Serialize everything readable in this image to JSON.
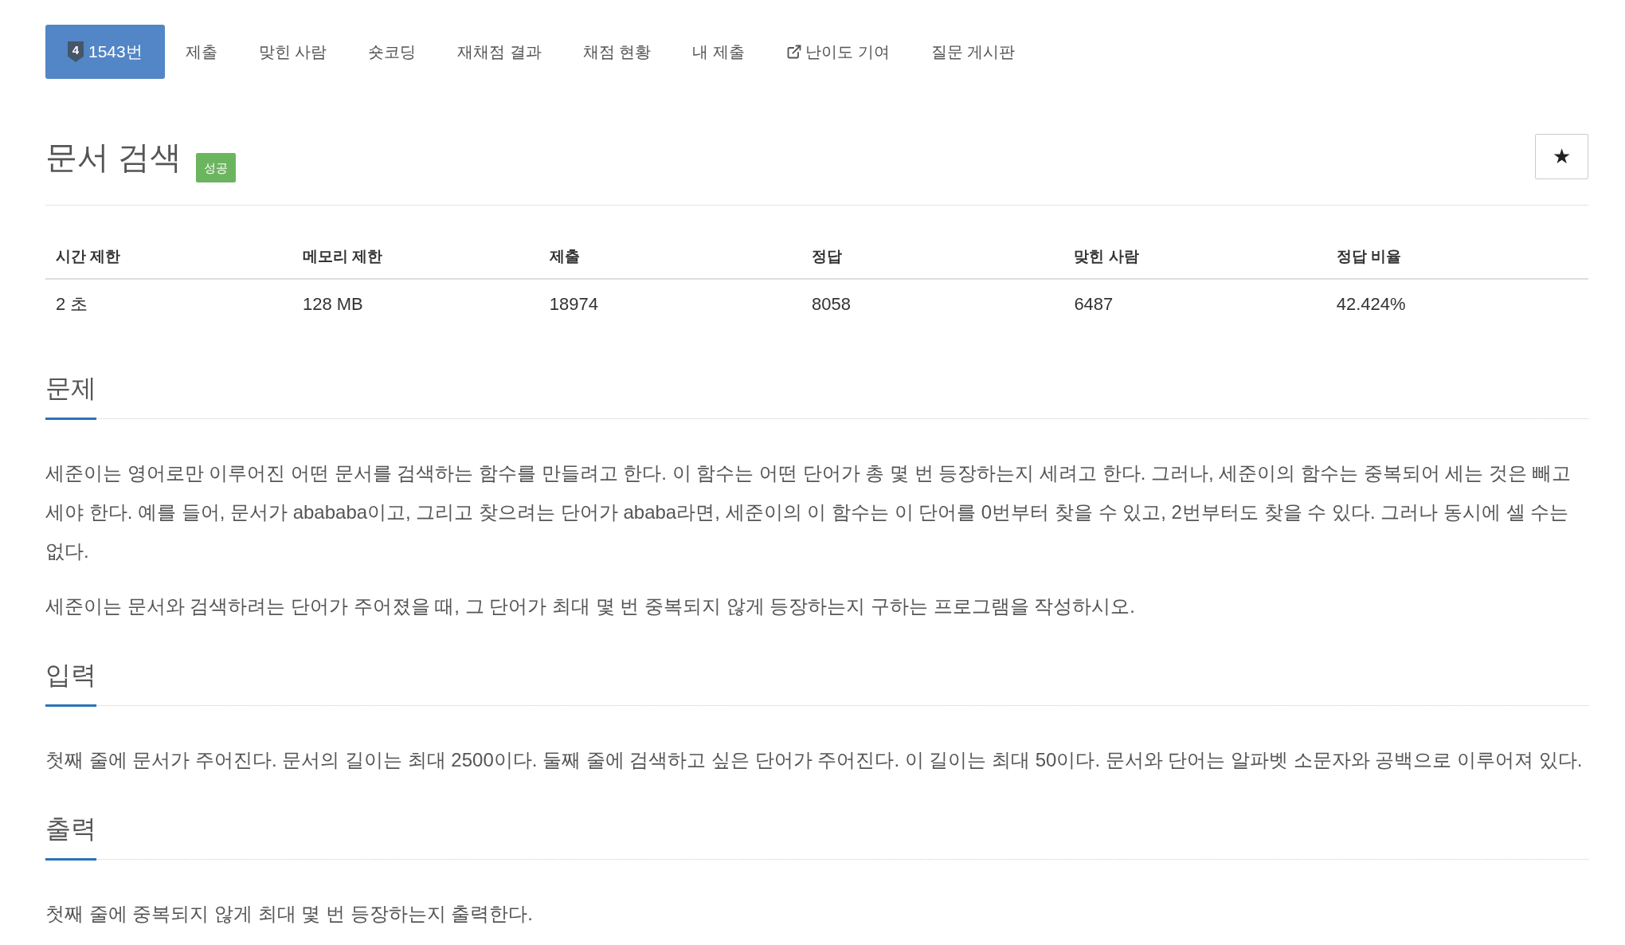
{
  "tabs": [
    {
      "label": "1543번",
      "tier": "4",
      "kind": "problem",
      "selected": true
    },
    {
      "label": "제출",
      "kind": "plain",
      "selected": false
    },
    {
      "label": "맞힌 사람",
      "kind": "plain",
      "selected": false
    },
    {
      "label": "숏코딩",
      "kind": "plain",
      "selected": false
    },
    {
      "label": "재채점 결과",
      "kind": "plain",
      "selected": false
    },
    {
      "label": "채점 현황",
      "kind": "plain",
      "selected": false
    },
    {
      "label": "내 제출",
      "kind": "plain",
      "selected": false
    },
    {
      "label": "난이도 기여",
      "kind": "external",
      "selected": false
    },
    {
      "label": "질문 게시판",
      "kind": "plain",
      "selected": false
    }
  ],
  "problem": {
    "title": "문서 검색",
    "status_badge": "성공",
    "star_button": "★"
  },
  "info_table": {
    "columns": [
      "시간 제한",
      "메모리 제한",
      "제출",
      "정답",
      "맞힌 사람",
      "정답 비율"
    ],
    "rows": [
      [
        "2 초",
        "128 MB",
        "18974",
        "8058",
        "6487",
        "42.424%"
      ]
    ]
  },
  "sections": [
    {
      "heading": "문제",
      "paragraphs": [
        "세준이는 영어로만 이루어진 어떤 문서를 검색하는 함수를 만들려고 한다. 이 함수는 어떤 단어가 총 몇 번 등장하는지 세려고 한다. 그러나, 세준이의 함수는 중복되어 세는 것은 빼고 세야 한다. 예를 들어, 문서가 abababa이고, 그리고 찾으려는 단어가 ababa라면, 세준이의 이 함수는 이 단어를 0번부터 찾을 수 있고, 2번부터도 찾을 수 있다. 그러나 동시에 셀 수는 없다.",
        "세준이는 문서와 검색하려는 단어가 주어졌을 때, 그 단어가 최대 몇 번 중복되지 않게 등장하는지 구하는 프로그램을 작성하시오."
      ]
    },
    {
      "heading": "입력",
      "paragraphs": [
        "첫째 줄에 문서가 주어진다. 문서의 길이는 최대 2500이다. 둘째 줄에 검색하고 싶은 단어가 주어진다. 이 길이는 최대 50이다. 문서와 단어는 알파벳 소문자와 공백으로 이루어져 있다."
      ]
    },
    {
      "heading": "출력",
      "paragraphs": [
        "첫째 줄에 중복되지 않게 최대 몇 번 등장하는지 출력한다."
      ]
    }
  ]
}
